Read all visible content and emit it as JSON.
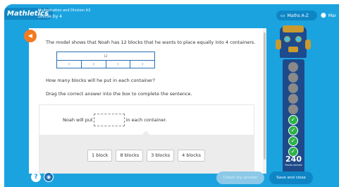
{
  "header": {
    "logo": "Mathletics",
    "course": "Multiplication and Division A3",
    "lesson": "Divide by 4",
    "maths_az_label": "Maths A-Z",
    "user_name": "Mar"
  },
  "question": {
    "intro": "The model shows that Noah has 12 blocks that he wants to place equally into 4 containers.",
    "bar_total": "12",
    "bar_parts": [
      "?",
      "?",
      "?",
      "?"
    ],
    "prompt": "How many blocks will he put in each container?",
    "instruction": "Drag the correct answer into the box to complete the sentence.",
    "sentence_before": "Noah will put",
    "sentence_after": "in each container.",
    "choices": [
      "1 block",
      "8 blocks",
      "3 blocks",
      "4 blocks"
    ]
  },
  "progress": {
    "points": "240",
    "points_label": "Points earned",
    "slots_completed": 4,
    "slots_total": 9
  },
  "footer": {
    "help_label": "?",
    "check_label": "Check my answer",
    "save_label": "Save and close"
  },
  "colors": {
    "brand_blue": "#1ba3e0",
    "dark_blue": "#0e86c5",
    "audio_orange": "#f47a1f",
    "success_green": "#2db34a"
  },
  "icons": {
    "audio": "speaker-icon",
    "maths_az": "book-icon",
    "user": "user-icon",
    "help": "help-icon",
    "settings": "settings-icon",
    "check": "checkmark-icon"
  }
}
